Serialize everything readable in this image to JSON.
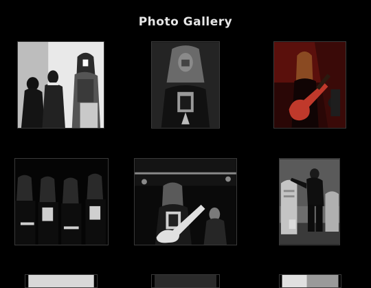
{
  "page": {
    "title": "Photo Gallery"
  },
  "gallery": {
    "photos": [
      {
        "id": "photo-1",
        "tone": "bw"
      },
      {
        "id": "photo-2",
        "tone": "bw"
      },
      {
        "id": "photo-3",
        "tone": "red"
      },
      {
        "id": "photo-4",
        "tone": "bw"
      },
      {
        "id": "photo-5",
        "tone": "bw"
      },
      {
        "id": "photo-6",
        "tone": "bw"
      },
      {
        "id": "photo-7",
        "tone": "bw"
      },
      {
        "id": "photo-8",
        "tone": "bw"
      },
      {
        "id": "photo-9",
        "tone": "bw"
      }
    ]
  },
  "colors": {
    "background": "#000000",
    "title": "#e6e6e6",
    "accent_red": "#8a1a14"
  }
}
